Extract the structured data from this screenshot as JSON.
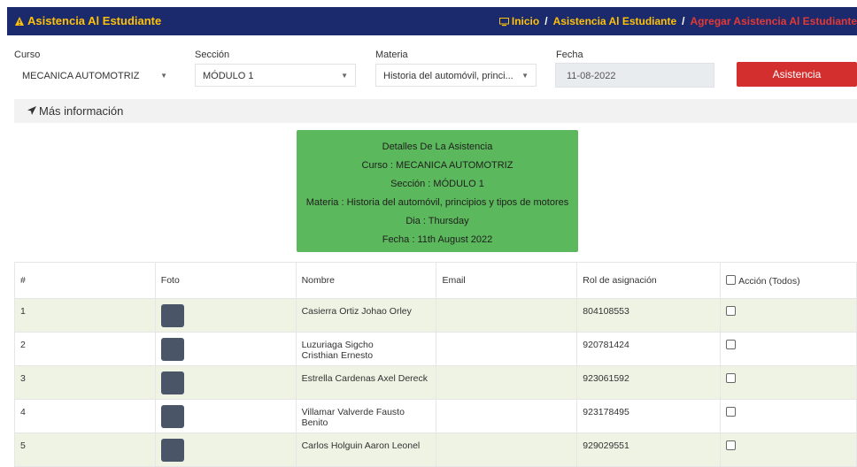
{
  "header": {
    "brand": "Asistencia Al Estudiante",
    "breadcrumb": {
      "home": "Inicio",
      "section": "Asistencia Al Estudiante",
      "current": "Agregar Asistencia Al Estudiante"
    }
  },
  "filters": {
    "curso": {
      "label": "Curso",
      "value": "MECANICA AUTOMOTRIZ"
    },
    "seccion": {
      "label": "Sección",
      "value": "MÓDULO 1"
    },
    "materia": {
      "label": "Materia",
      "value": "Historia del automóvil, princi..."
    },
    "fecha": {
      "label": "Fecha",
      "value": "11-08-2022"
    },
    "submit": "Asistencia"
  },
  "more_info": "Más información",
  "details": {
    "title": "Detalles De La Asistencia",
    "curso": "Curso : MECANICA AUTOMOTRIZ",
    "seccion": "Sección : MÓDULO 1",
    "materia": "Materia : Historia del automóvil, principios y tipos de motores",
    "dia": "Dia : Thursday",
    "fecha": "Fecha : 11th August 2022"
  },
  "table": {
    "headers": [
      "#",
      "Foto",
      "Nombre",
      "Email",
      "Rol de asignación",
      "Acción (Todos)"
    ],
    "rows": [
      {
        "num": "1",
        "nombre": "Casierra Ortiz Johao Orley",
        "email": "",
        "rol": "804108553"
      },
      {
        "num": "2",
        "nombre": "Luzuriaga Sigcho Cristhian Ernesto",
        "email": "",
        "rol": "920781424"
      },
      {
        "num": "3",
        "nombre": "Estrella Cardenas Axel Dereck",
        "email": "",
        "rol": "923061592"
      },
      {
        "num": "4",
        "nombre": "Villamar Valverde Fausto Benito",
        "email": "",
        "rol": "923178495"
      },
      {
        "num": "5",
        "nombre": "Carlos Holguin Aaron Leonel",
        "email": "",
        "rol": "929029551"
      }
    ]
  },
  "colors": {
    "topbar": "#1a2a6c",
    "brand": "#ffc107",
    "accent_red": "#d32f2f",
    "detail_green": "#5cb85c"
  }
}
